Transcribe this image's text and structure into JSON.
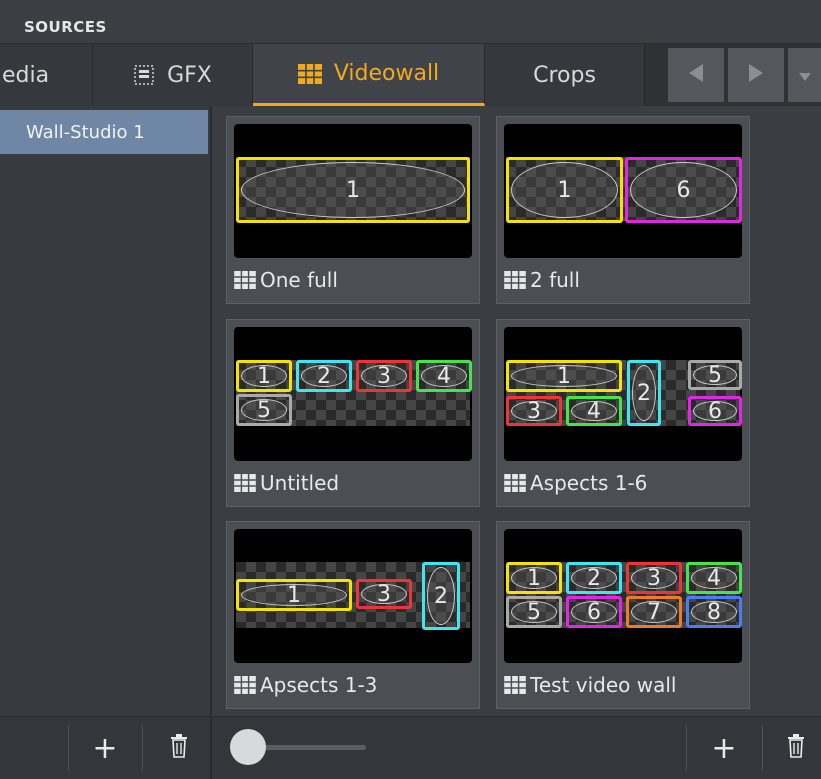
{
  "header": {
    "title": "SOURCES"
  },
  "tabs": [
    {
      "label": "edia",
      "icon": "media-icon"
    },
    {
      "label": "GFX",
      "icon": "gfx-icon"
    },
    {
      "label": "Videowall",
      "icon": "videowall-grid-icon",
      "active": true
    },
    {
      "label": "Crops"
    }
  ],
  "nav": {
    "prev_icon": "chevron-left-icon",
    "next_icon": "chevron-right-icon",
    "menu_icon": "chevron-down-icon"
  },
  "sidebar": {
    "items": [
      {
        "label": "Wall-Studio 1",
        "selected": true
      }
    ]
  },
  "walls": [
    {
      "name": "One full",
      "cells": [
        "1"
      ]
    },
    {
      "name": "2 full",
      "cells": [
        "1",
        "6"
      ]
    },
    {
      "name": "Untitled",
      "cells": [
        "1",
        "2",
        "3",
        "4",
        "5"
      ]
    },
    {
      "name": "Aspects 1-6",
      "cells": [
        "1",
        "2",
        "3",
        "4",
        "5",
        "6"
      ]
    },
    {
      "name": "Apsects 1-3",
      "cells": [
        "1",
        "3",
        "2"
      ]
    },
    {
      "name": "Test video wall",
      "cells": [
        "1",
        "2",
        "3",
        "4",
        "5",
        "6",
        "7",
        "8"
      ]
    }
  ],
  "colors": {
    "accent": "#f2a91c",
    "selected_item": "#6f87a4",
    "yellow": "#f5e400",
    "cyan": "#3fe6f2",
    "red": "#ee3535",
    "green": "#46e34a",
    "gray": "#a9a9a9",
    "magenta": "#e326e3",
    "orange": "#f07a2a",
    "blue": "#4d7cf2"
  },
  "footer": {
    "left_add_label": "+",
    "left_delete_icon": "trash-icon",
    "right_add_label": "+",
    "right_delete_icon": "trash-icon",
    "zoom_level": 0.25
  }
}
